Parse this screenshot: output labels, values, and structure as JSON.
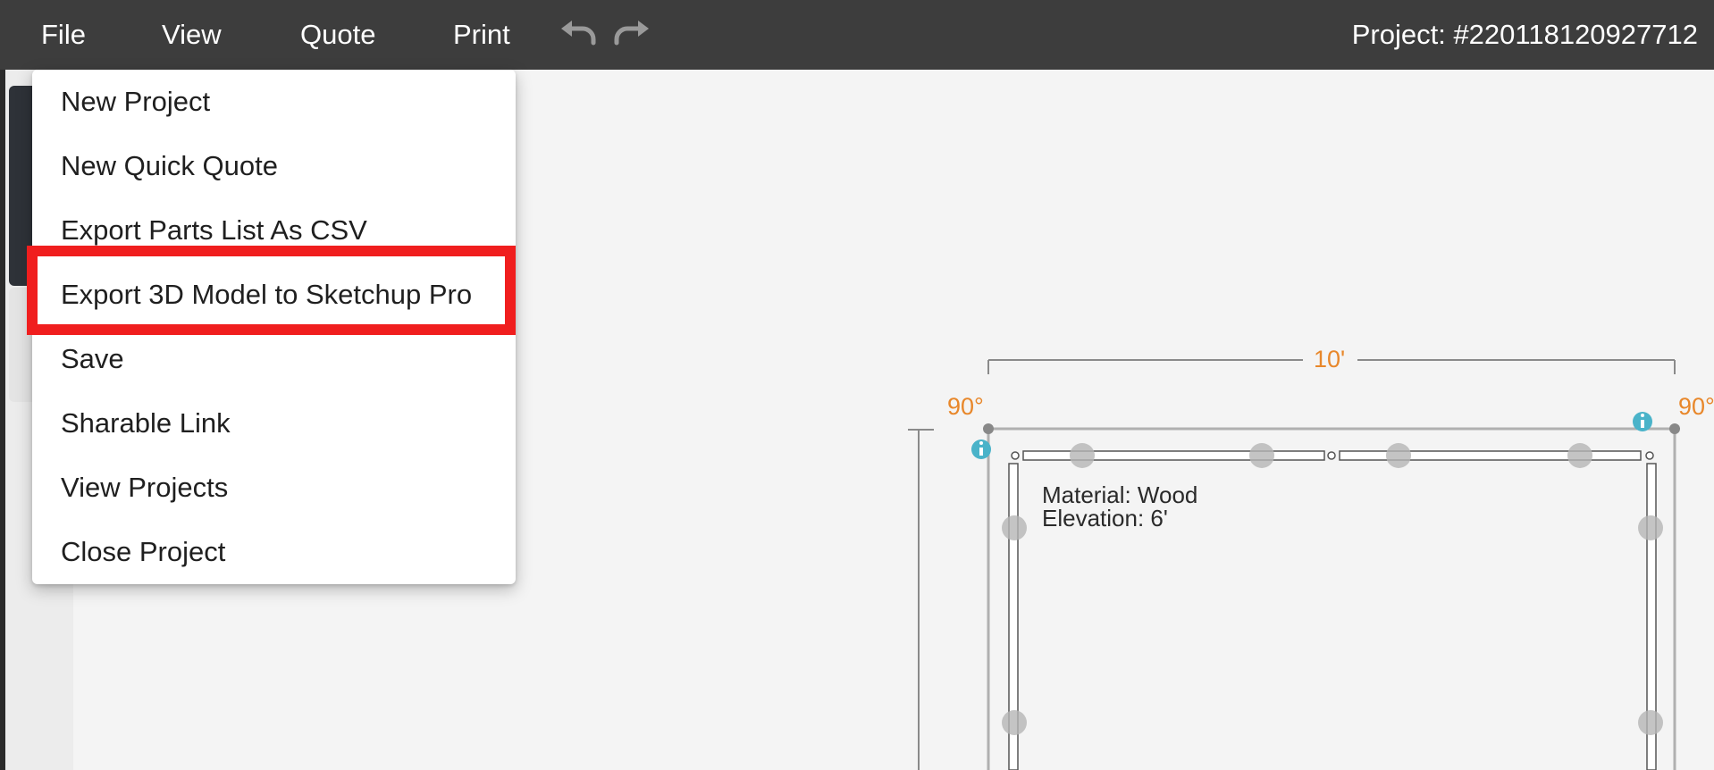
{
  "menubar": {
    "file_label": "File",
    "view_label": "View",
    "quote_label": "Quote",
    "print_label": "Print",
    "undo_icon": "undo-icon",
    "redo_icon": "redo-icon",
    "project_label": "Project: #220118120927712"
  },
  "file_menu": {
    "items": [
      {
        "label": "New Project"
      },
      {
        "label": "New Quick Quote"
      },
      {
        "label": "Export Parts List As CSV"
      },
      {
        "label": "Export 3D Model to Sketchup Pro"
      },
      {
        "label": "Save"
      },
      {
        "label": "Sharable Link"
      },
      {
        "label": "View Projects"
      },
      {
        "label": "Close Project"
      }
    ],
    "highlighted_item": "Export 3D Model to Sketchup Pro",
    "highlight_color": "#f01e1e"
  },
  "drawing": {
    "width_dimension": "10'",
    "angle_left": "90°",
    "angle_right": "90°",
    "material_text": "Material: Wood",
    "elevation_text": "Elevation: 6'",
    "dimension_color": "#e8872a",
    "info_icon_color": "#4ab3c9"
  },
  "colors": {
    "menubar_bg": "#3d3d3d",
    "canvas_bg": "#f4f4f4"
  }
}
